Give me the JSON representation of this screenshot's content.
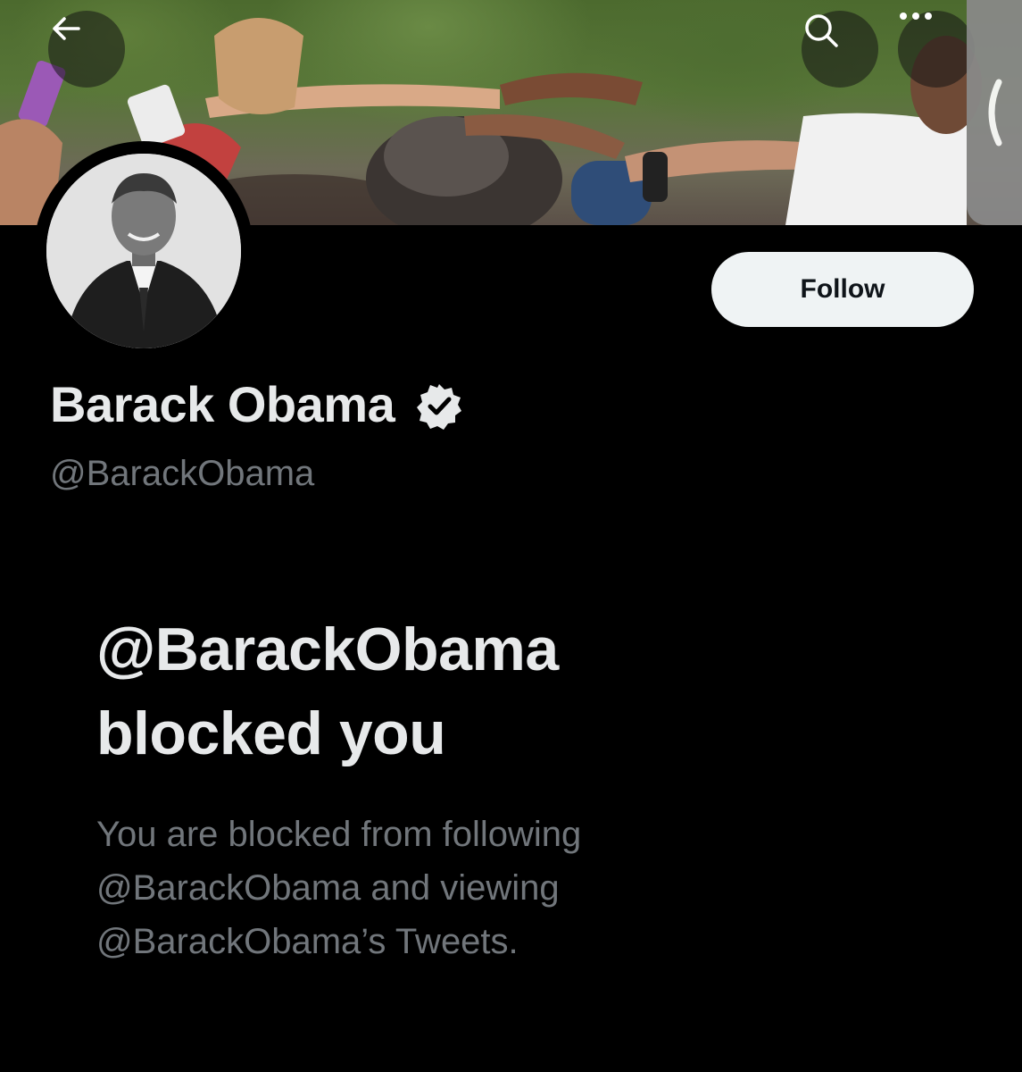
{
  "profile": {
    "display_name": "Barack Obama",
    "handle": "@BarackObama",
    "verified": true
  },
  "actions": {
    "follow_label": "Follow"
  },
  "icons": {
    "back": "arrow-left-icon",
    "search": "search-icon",
    "more": "more-horizontal-icon",
    "side": "chevron-left-icon",
    "verified": "verified-badge-icon"
  },
  "blocked": {
    "title_line1": "@BarackObama",
    "title_line2": "blocked you",
    "message_line1": "You are blocked from following",
    "message_line2": "@BarackObama and viewing",
    "message_line3": "@BarackObama’s Tweets."
  },
  "colors": {
    "background": "#000000",
    "primary_text": "#e7e9ea",
    "secondary_text": "#71767b",
    "follow_button_bg": "#eff3f4",
    "follow_button_text": "#0f1419"
  }
}
